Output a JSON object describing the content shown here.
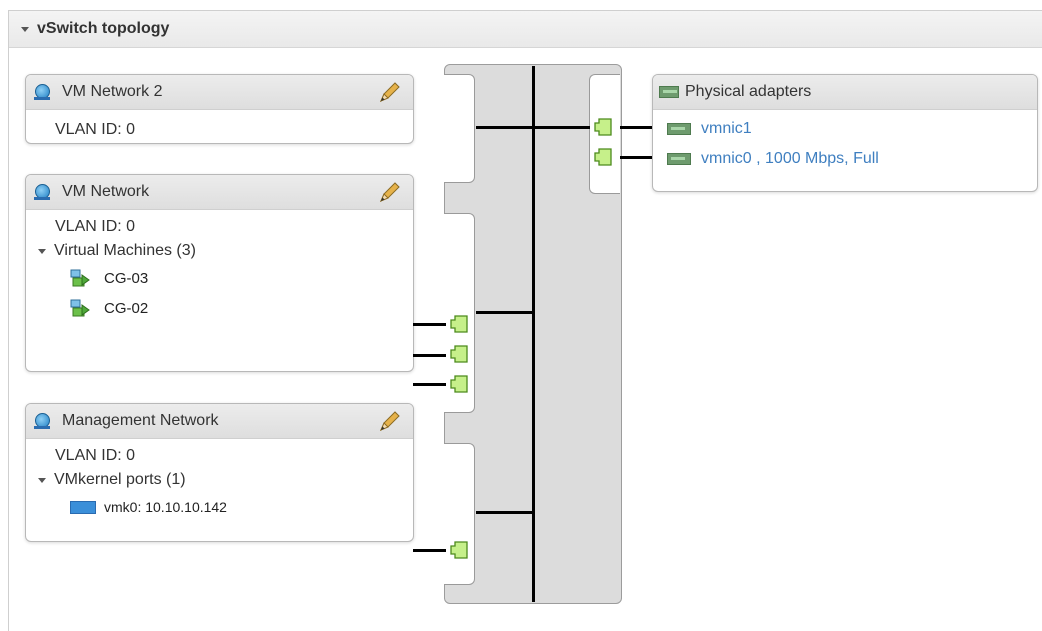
{
  "panel": {
    "title": "vSwitch topology"
  },
  "portgroups": [
    {
      "name": "VM Network 2",
      "vlan": "VLAN ID: 0"
    },
    {
      "name": "VM Network",
      "vlan": "VLAN ID: 0",
      "section_label": "Virtual Machines (3)",
      "items": [
        "CG-03",
        "CG-02"
      ]
    },
    {
      "name": "Management Network",
      "vlan": "VLAN ID: 0",
      "section_label": "VMkernel ports (1)",
      "items": [
        "vmk0: 10.10.10.142"
      ]
    }
  ],
  "physical": {
    "title": "Physical adapters",
    "adapters": [
      "vmnic1",
      "vmnic0 , 1000 Mbps, Full"
    ]
  },
  "colors": {
    "link": "#3f7fc0",
    "port_fill": "#c6f08a",
    "port_stroke": "#4c8a1c",
    "wire": "#000000"
  },
  "icons": [
    "collapse-arrow-icon",
    "network-icon",
    "pencil-icon",
    "vm-icon",
    "vmkernel-icon",
    "nic-icon",
    "port-icon"
  ]
}
